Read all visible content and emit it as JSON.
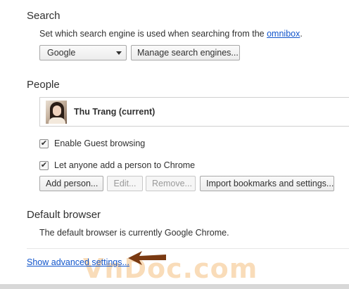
{
  "search": {
    "title": "Search",
    "description_prefix": "Set which search engine is used when searching from the ",
    "omnibox_link": "omnibox",
    "description_suffix": ".",
    "engine_selected": "Google",
    "manage_button": "Manage search engines..."
  },
  "people": {
    "title": "People",
    "profile_name": "Thu Trang (current)",
    "guest_label": "Enable Guest browsing",
    "guest_checked": true,
    "add_person_label": "Let anyone add a person to Chrome",
    "add_person_checked": true,
    "buttons": {
      "add": "Add person...",
      "edit": "Edit...",
      "remove": "Remove...",
      "import": "Import bookmarks and settings..."
    }
  },
  "default_browser": {
    "title": "Default browser",
    "status": "The default browser is currently Google Chrome."
  },
  "advanced_link": "Show advanced settings...",
  "watermark": "VnDoc.com",
  "colors": {
    "link": "#1155cc",
    "arrow": "#7a3a12",
    "watermark": "#f0a64a"
  },
  "icons": {
    "checkmark": "✔",
    "dropdown": "chevron-down-icon"
  }
}
